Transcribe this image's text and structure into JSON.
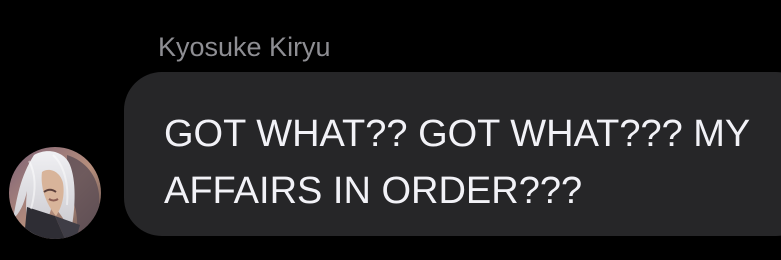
{
  "message": {
    "sender_name": "Kyosuke Kiryu",
    "text": "GOT WHAT?? GOT WHAT??? MY AFFAIRS IN ORDER???"
  },
  "avatar": {
    "icon": "profile-avatar-icon"
  },
  "colors": {
    "background": "#000000",
    "bubble": "#262628",
    "sender_name": "#8e8e93",
    "message_text": "#f2f2f7"
  }
}
